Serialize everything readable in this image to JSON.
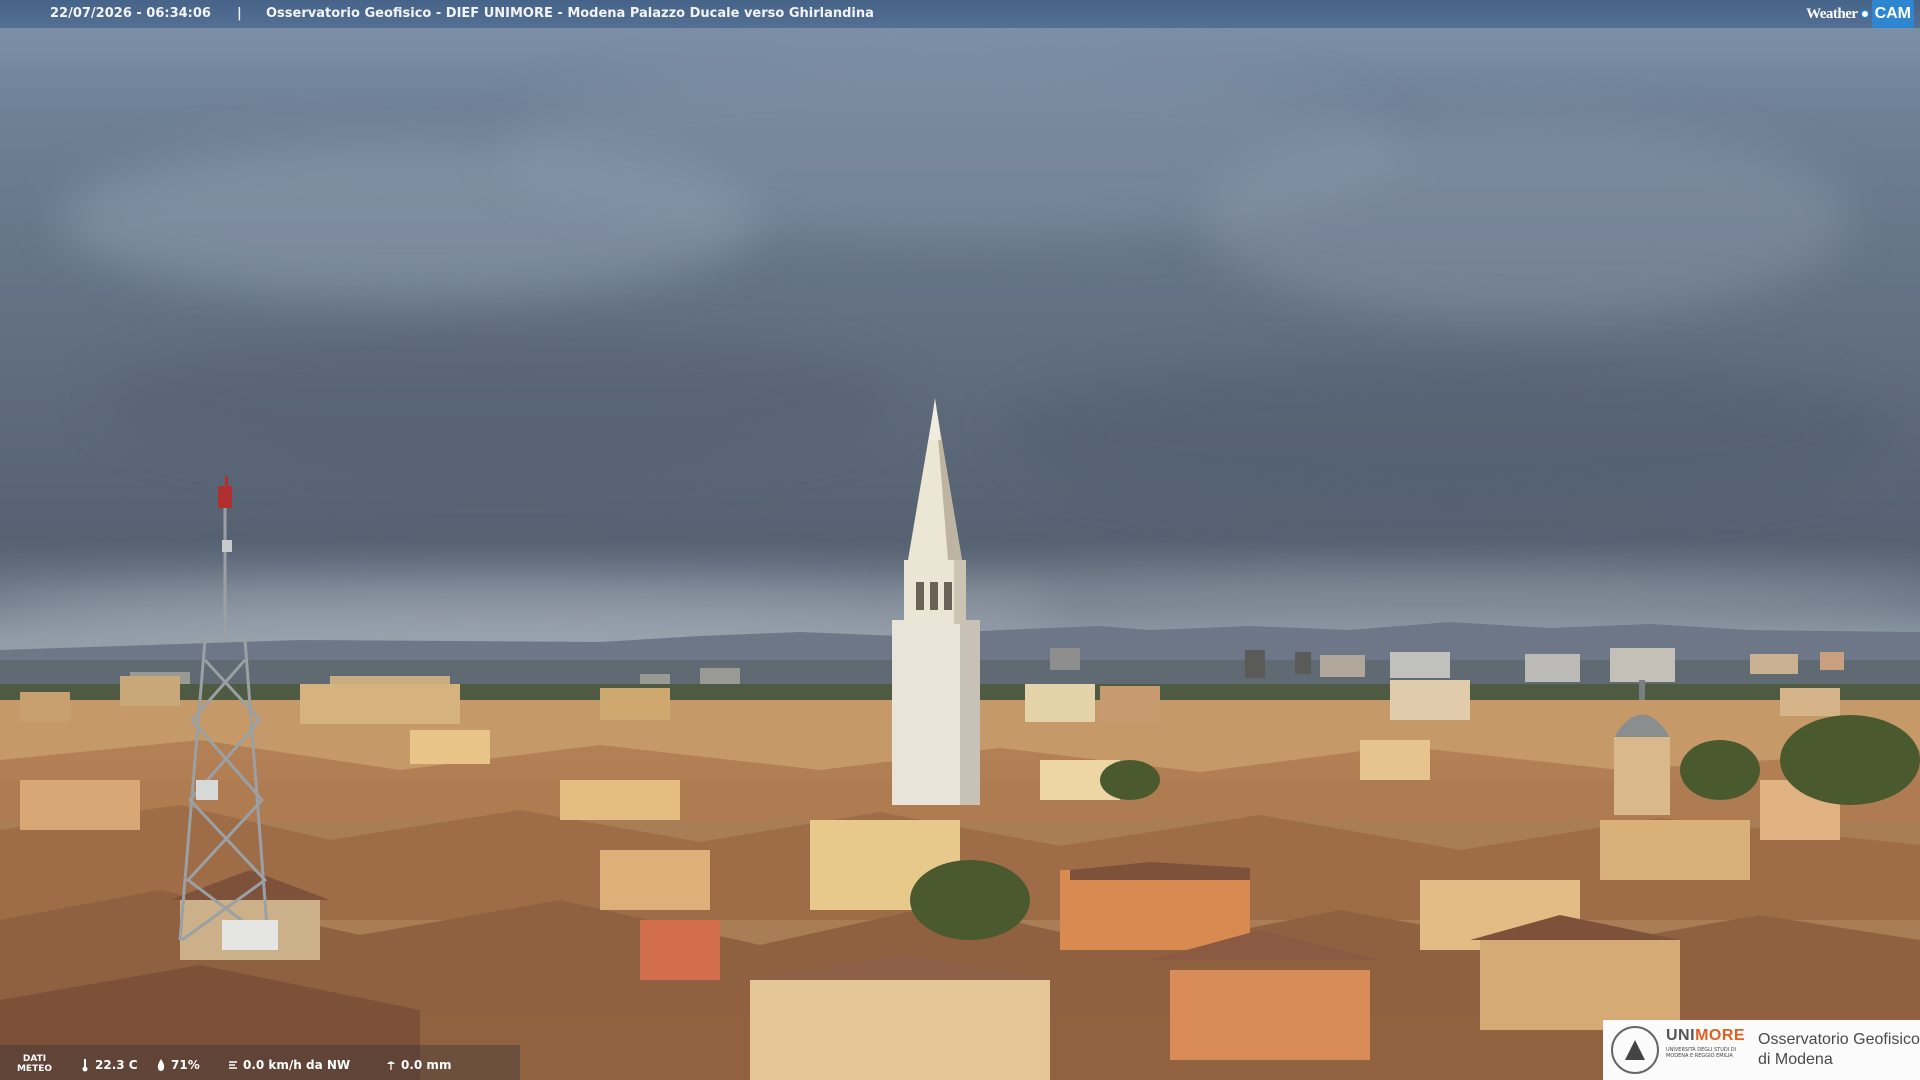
{
  "header": {
    "datetime": "22/07/2026 - 06:34:06",
    "separator": "|",
    "title": "Osservatorio Geofisico - DIEF UNIMORE - Modena Palazzo Ducale verso Ghirlandina"
  },
  "brand": {
    "weathercam_word": "Weather",
    "weathercam_cam": "CAM"
  },
  "meteo": {
    "label_line1": "DATI",
    "label_line2": "METEO",
    "temperature": "22.3 C",
    "humidity": "71%",
    "wind": "0.0 km/h da NW",
    "rain": "0.0 mm",
    "icons": [
      "thermometer-icon",
      "droplet-icon",
      "wind-icon",
      "rain-gauge-icon"
    ]
  },
  "logo_card": {
    "uni_part1": "UNI",
    "uni_part2": "MORE",
    "uni_subtitle": "UNIVERSITÀ DEGLI STUDI DI MODENA E REGGIO EMILIA",
    "observatory_line1": "Osservatorio Geofisico",
    "observatory_line2": "di Modena",
    "seal_icon": "university-seal-icon"
  },
  "colors": {
    "topbar": "#466a94",
    "accent_orange": "#e06020",
    "weathercam_blue": "#2e86d0"
  }
}
